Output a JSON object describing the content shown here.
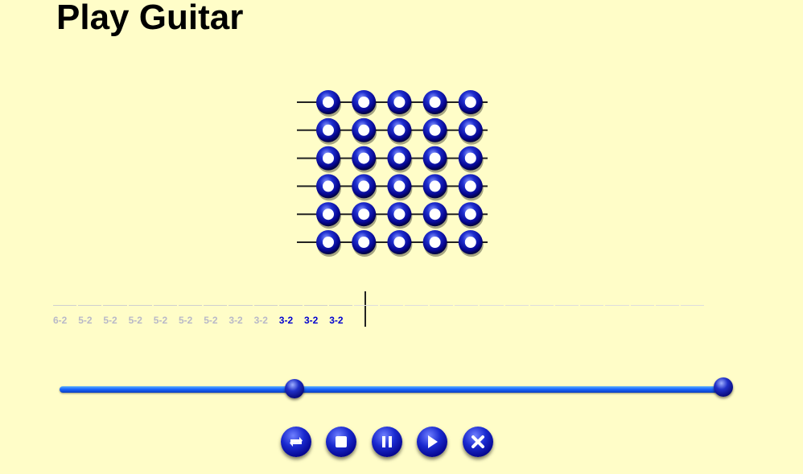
{
  "title": "Play Guitar",
  "fretboard": {
    "strings": 6,
    "frets": 5
  },
  "tab": {
    "notes": [
      {
        "label": "6-2",
        "state": "played"
      },
      {
        "label": "5-2",
        "state": "played"
      },
      {
        "label": "5-2",
        "state": "played"
      },
      {
        "label": "5-2",
        "state": "played"
      },
      {
        "label": "5-2",
        "state": "played"
      },
      {
        "label": "5-2",
        "state": "played"
      },
      {
        "label": "5-2",
        "state": "played"
      },
      {
        "label": "3-2",
        "state": "played"
      },
      {
        "label": "3-2",
        "state": "played"
      },
      {
        "label": "3-2",
        "state": "current"
      },
      {
        "label": "3-2",
        "state": "current"
      },
      {
        "label": "3-2",
        "state": "current"
      }
    ],
    "upcoming_slots": 14
  },
  "playback": {
    "progress": 0.35
  },
  "controls": [
    {
      "name": "repeat-button",
      "icon": "repeat-icon"
    },
    {
      "name": "stop-button",
      "icon": "stop-icon"
    },
    {
      "name": "pause-button",
      "icon": "pause-icon"
    },
    {
      "name": "play-button",
      "icon": "play-icon"
    },
    {
      "name": "close-button",
      "icon": "close-icon"
    }
  ],
  "colors": {
    "background": "#fffdc8",
    "current_note": "#0000d0",
    "played_note": "#b8b8c8",
    "accent": "#1a2ad0"
  }
}
